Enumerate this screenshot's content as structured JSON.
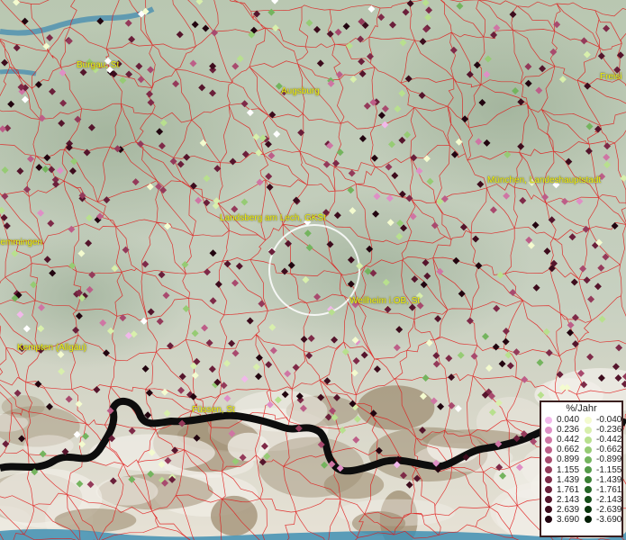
{
  "cities": [
    {
      "id": "burgau",
      "name": "Burgau, St"
    },
    {
      "id": "augsburg",
      "name": "Augsburg"
    },
    {
      "id": "freising",
      "name": "Freisi"
    },
    {
      "id": "muenchen",
      "name": "München, Landeshauptstadt"
    },
    {
      "id": "landsberg",
      "name": "Landsberg am Lech, GKSt"
    },
    {
      "id": "memmingen",
      "name": "Memmingen"
    },
    {
      "id": "weilheim",
      "name": "Weilheim i.OB, St"
    },
    {
      "id": "kempten",
      "name": "Kempten (Allgäu)"
    },
    {
      "id": "fuessen",
      "name": "Füssen, St"
    }
  ],
  "legend": {
    "title": "%/Jahr",
    "positive": [
      {
        "label": "0.040",
        "color": "#f1b8ea"
      },
      {
        "label": "0.236",
        "color": "#df8fc6"
      },
      {
        "label": "0.442",
        "color": "#cf75a4"
      },
      {
        "label": "0.662",
        "color": "#bd5e88"
      },
      {
        "label": "0.899",
        "color": "#a84a6e"
      },
      {
        "label": "1.155",
        "color": "#943a5a"
      },
      {
        "label": "1.439",
        "color": "#7e2a48"
      },
      {
        "label": "1.761",
        "color": "#6a1f3a"
      },
      {
        "label": "2.143",
        "color": "#55152c"
      },
      {
        "label": "2.639",
        "color": "#3d0c1d"
      },
      {
        "label": "3.690",
        "color": "#220510"
      }
    ],
    "negative": [
      {
        "label": "-0.040",
        "color": "#f4fbcf"
      },
      {
        "label": "-0.236",
        "color": "#d8efac"
      },
      {
        "label": "-0.442",
        "color": "#b8e08e"
      },
      {
        "label": "-0.662",
        "color": "#96cb74"
      },
      {
        "label": "-0.899",
        "color": "#74b45e"
      },
      {
        "label": "-1.155",
        "color": "#549a48"
      },
      {
        "label": "-1.439",
        "color": "#3a7f34"
      },
      {
        "label": "-1.761",
        "color": "#256526"
      },
      {
        "label": "-2.143",
        "color": "#154d18"
      },
      {
        "label": "-2.639",
        "color": "#0a350d"
      },
      {
        "label": "-3.690",
        "color": "#031d05"
      }
    ]
  },
  "colors": {
    "boundary": "#e01818",
    "circle": "#ffffff",
    "city_label": "#f2f20a",
    "water": "#4a8fb0",
    "country_border": "#0d0d0d"
  }
}
